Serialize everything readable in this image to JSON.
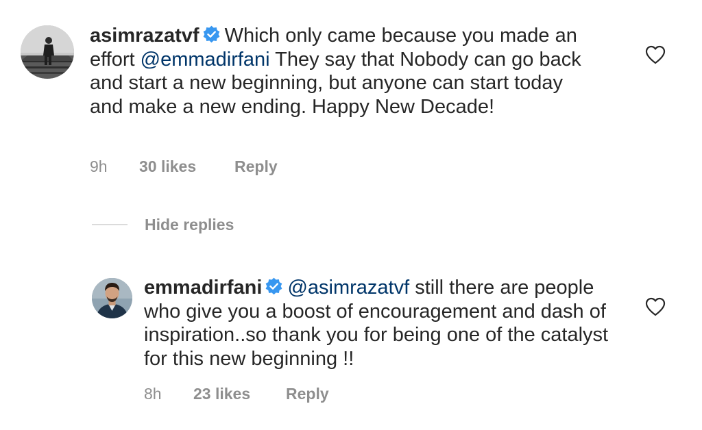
{
  "comments": [
    {
      "username": "asimrazatvf",
      "text_before": "Which only came because you made an effort ",
      "mention": "@emmadirfani",
      "text_after": "  They say that Nobody can go back and start a new beginning, but anyone can start today and make a new ending. Happy New Decade!",
      "time": "9h",
      "likes": "30 likes",
      "reply_label": "Reply",
      "verified": true,
      "liked": false
    }
  ],
  "replies_toggle": {
    "label": "Hide replies"
  },
  "replies": [
    {
      "username": "emmadirfani",
      "mention": "@asimrazatvf",
      "text_after": " still there are people who give you a boost of encouragement and dash of inspiration..so thank you for being one of the catalyst for this new beginning !!",
      "time": "8h",
      "likes": "23 likes",
      "reply_label": "Reply",
      "verified": true,
      "liked": false
    }
  ],
  "colors": {
    "text": "#262626",
    "mention": "#003569",
    "secondary": "#8e8e8e",
    "verified": "#3897f0",
    "divider": "#dbdbdb"
  },
  "icons": {
    "verified": "verified-badge-icon",
    "like": "heart-outline-icon"
  }
}
